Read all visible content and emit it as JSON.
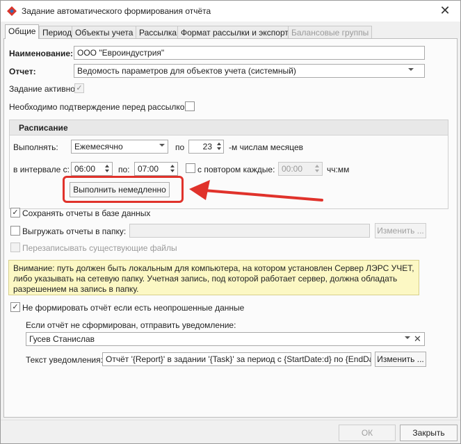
{
  "window": {
    "title": "Задание автоматического формирования отчёта",
    "close_glyph": "✕"
  },
  "tabs": [
    {
      "label": "Общие",
      "active": true
    },
    {
      "label": "Период"
    },
    {
      "label": "Объекты учета"
    },
    {
      "label": "Рассылка"
    },
    {
      "label": "Формат рассылки и экспорта"
    },
    {
      "label": "Балансовые группы",
      "disabled": true
    }
  ],
  "general": {
    "name_label": "Наименование:",
    "name_value": "ООО \"Евроиндустрия\"",
    "report_label": "Отчет:",
    "report_value": "Ведомость параметров для объектов учета (системный)",
    "active_label": "Задание активно",
    "active_checked": true,
    "confirm_label": "Необходимо подтверждение перед рассылкой",
    "confirm_checked": false
  },
  "schedule": {
    "header": "Расписание",
    "run_label": "Выполнять:",
    "run_value": "Ежемесячно",
    "on_label": "по",
    "day_value": "23",
    "day_suffix": "-м числам месяцев",
    "interval_label": "в интервале с:",
    "from_value": "06:00",
    "to_label": "по:",
    "to_value": "07:00",
    "repeat_label": "с повтором каждые:",
    "repeat_checked": false,
    "repeat_value": "00:00",
    "repeat_unit": "чч:мм",
    "run_now_button": "Выполнить немедленно"
  },
  "storage": {
    "save_db_label": "Сохранять отчеты в базе данных",
    "save_db_checked": true,
    "export_folder_label": "Выгружать отчеты в папку:",
    "export_folder_checked": false,
    "folder_value": "",
    "change_button": "Изменить ...",
    "overwrite_label": "Перезаписывать существующие файлы",
    "overwrite_checked": false
  },
  "warning": {
    "text": "Внимание: путь должен быть локальным для компьютера, на котором установлен Сервер ЛЭРС УЧЕТ, либо указывать на сетевую папку. Учетная запись, под которой работает сервер, должна обладать разрешением на запись в папку."
  },
  "notify": {
    "skip_label": "Не формировать отчёт если есть неопрошенные данные",
    "skip_checked": true,
    "send_label": "Если отчёт не сформирован, отправить уведомление:",
    "recipient_value": "Гусев Станислав",
    "text_label": "Текст уведомления:",
    "text_value": "Отчёт '{Report}' в задании '{Task}' за период с {StartDate:d} по {EndDate:d",
    "change_button": "Изменить ..."
  },
  "footer": {
    "ok_button": "ОК",
    "close_button": "Закрыть"
  },
  "colors": {
    "annotation_red": "#e0322b",
    "icon_red": "#d9342b",
    "icon_blue": "#2f6db5"
  },
  "glyphs": {
    "check": "✓",
    "clear": "✕"
  }
}
